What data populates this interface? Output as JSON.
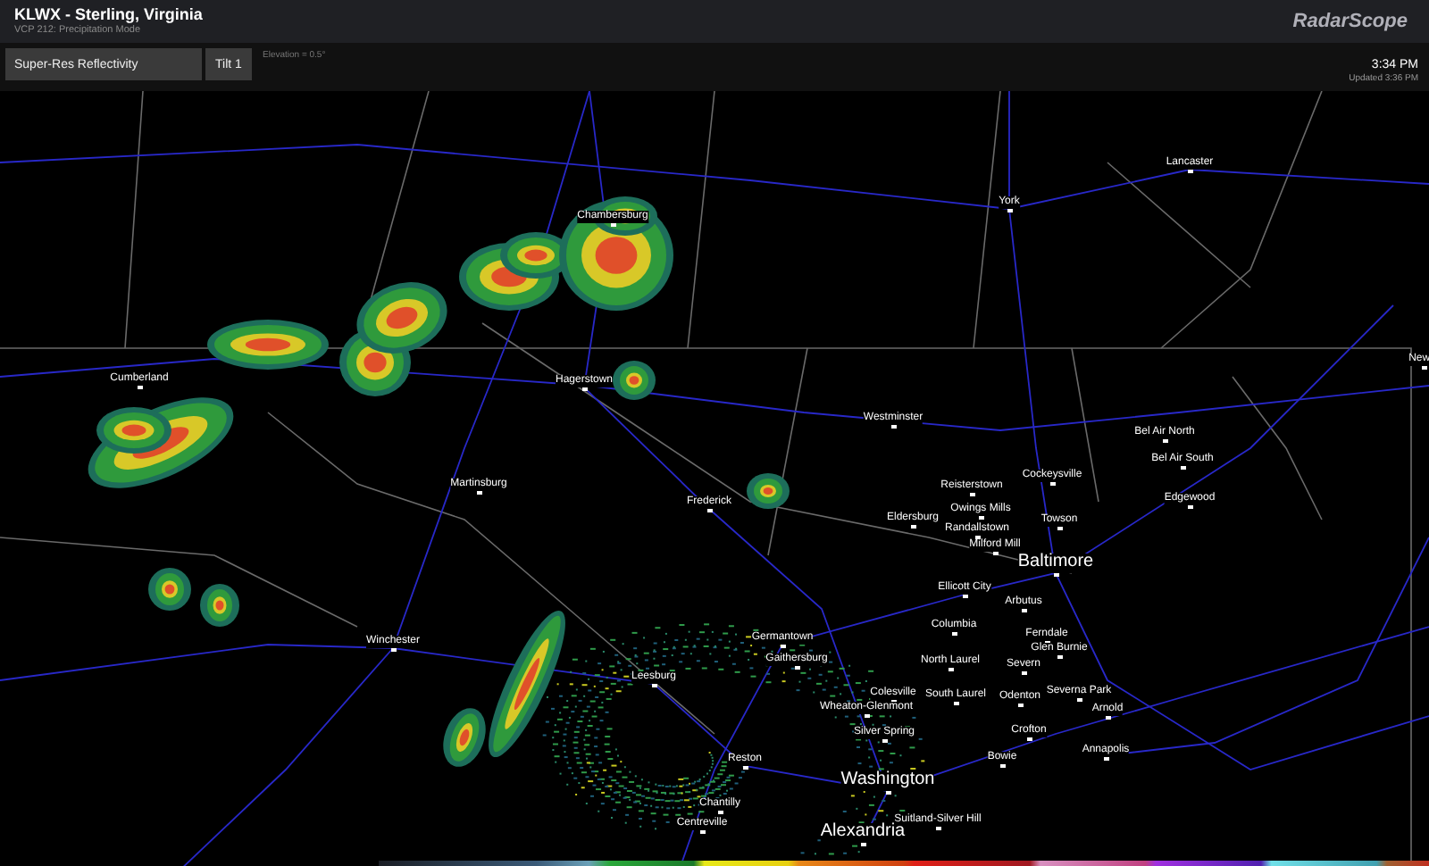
{
  "header": {
    "title": "KLWX - Sterling, Virginia",
    "subtitle": "VCP 212: Precipitation Mode",
    "logo": "RadarScope"
  },
  "toolbar": {
    "product": "Super-Res Reflectivity",
    "tilt": "Tilt 1",
    "elevation": "Elevation = 0.5°",
    "time": "3:34 PM",
    "updated": "Updated 3:36 PM"
  },
  "map": {
    "cities": [
      {
        "name": "Lancaster",
        "kind": "town"
      },
      {
        "name": "York",
        "kind": "town"
      },
      {
        "name": "Chambersburg",
        "kind": "town"
      },
      {
        "name": "Cumberland",
        "kind": "town"
      },
      {
        "name": "Hagerstown",
        "kind": "town"
      },
      {
        "name": "New",
        "kind": "town"
      },
      {
        "name": "Westminster",
        "kind": "town"
      },
      {
        "name": "Bel Air North",
        "kind": "town"
      },
      {
        "name": "Bel Air South",
        "kind": "town"
      },
      {
        "name": "Martinsburg",
        "kind": "town"
      },
      {
        "name": "Frederick",
        "kind": "town"
      },
      {
        "name": "Cockeysville",
        "kind": "town"
      },
      {
        "name": "Reisterstown",
        "kind": "town"
      },
      {
        "name": "Edgewood",
        "kind": "town"
      },
      {
        "name": "Owings Mills",
        "kind": "town"
      },
      {
        "name": "Eldersburg",
        "kind": "town"
      },
      {
        "name": "Towson",
        "kind": "town"
      },
      {
        "name": "Randallstown",
        "kind": "town"
      },
      {
        "name": "Milford Mill",
        "kind": "town"
      },
      {
        "name": "Baltimore",
        "kind": "major"
      },
      {
        "name": "Ellicott City",
        "kind": "town"
      },
      {
        "name": "Arbutus",
        "kind": "town"
      },
      {
        "name": "Columbia",
        "kind": "town"
      },
      {
        "name": "Ferndale",
        "kind": "town"
      },
      {
        "name": "Winchester",
        "kind": "town"
      },
      {
        "name": "Germantown",
        "kind": "town"
      },
      {
        "name": "Glen Burnie",
        "kind": "town"
      },
      {
        "name": "Gaithersburg",
        "kind": "town"
      },
      {
        "name": "North Laurel",
        "kind": "town"
      },
      {
        "name": "Severn",
        "kind": "town"
      },
      {
        "name": "Leesburg",
        "kind": "town"
      },
      {
        "name": "Colesville",
        "kind": "town"
      },
      {
        "name": "Severna Park",
        "kind": "town"
      },
      {
        "name": "South Laurel",
        "kind": "town"
      },
      {
        "name": "Odenton",
        "kind": "town"
      },
      {
        "name": "Wheaton-Glenmont",
        "kind": "town"
      },
      {
        "name": "Arnold",
        "kind": "town"
      },
      {
        "name": "Silver Spring",
        "kind": "town"
      },
      {
        "name": "Crofton",
        "kind": "town"
      },
      {
        "name": "Annapolis",
        "kind": "town"
      },
      {
        "name": "Reston",
        "kind": "town"
      },
      {
        "name": "Bowie",
        "kind": "town"
      },
      {
        "name": "Washington",
        "kind": "major"
      },
      {
        "name": "Chantilly",
        "kind": "town"
      },
      {
        "name": "Suitland-Silver Hill",
        "kind": "town"
      },
      {
        "name": "Centreville",
        "kind": "town"
      },
      {
        "name": "Alexandria",
        "kind": "major"
      }
    ]
  }
}
